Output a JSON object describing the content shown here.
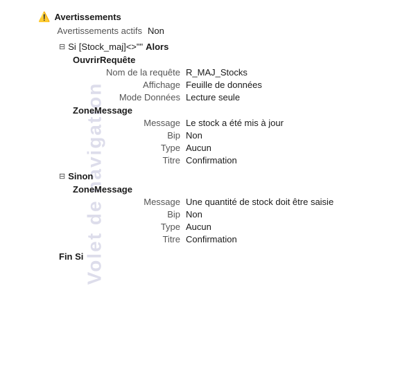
{
  "watermark": {
    "text": "Volet de navigation"
  },
  "warnings": {
    "title": "Avertissements",
    "active_label": "Avertissements actifs",
    "active_value": "Non"
  },
  "si_block": {
    "collapse_icon": "⊟",
    "keyword": "Si",
    "condition": "[Stock_maj]<>\"\"",
    "then_keyword": "Alors",
    "open_request": {
      "title": "OuvrirRequête",
      "fields": [
        {
          "label": "Nom de la requête",
          "value": "R_MAJ_Stocks"
        },
        {
          "label": "Affichage",
          "value": "Feuille de données"
        },
        {
          "label": "Mode Données",
          "value": "Lecture seule"
        }
      ]
    },
    "zone_message_then": {
      "title": "ZoneMessage",
      "fields": [
        {
          "label": "Message",
          "value": "Le stock a été mis à jour"
        },
        {
          "label": "Bip",
          "value": "Non"
        },
        {
          "label": "Type",
          "value": "Aucun"
        },
        {
          "label": "Titre",
          "value": "Confirmation"
        }
      ]
    }
  },
  "sinon_block": {
    "collapse_icon": "⊟",
    "keyword": "Sinon",
    "zone_message": {
      "title": "ZoneMessage",
      "fields": [
        {
          "label": "Message",
          "value": "Une quantité de stock doit être saisie"
        },
        {
          "label": "Bip",
          "value": "Non"
        },
        {
          "label": "Type",
          "value": "Aucun"
        },
        {
          "label": "Titre",
          "value": "Confirmation"
        }
      ]
    }
  },
  "fin_si": "Fin Si"
}
